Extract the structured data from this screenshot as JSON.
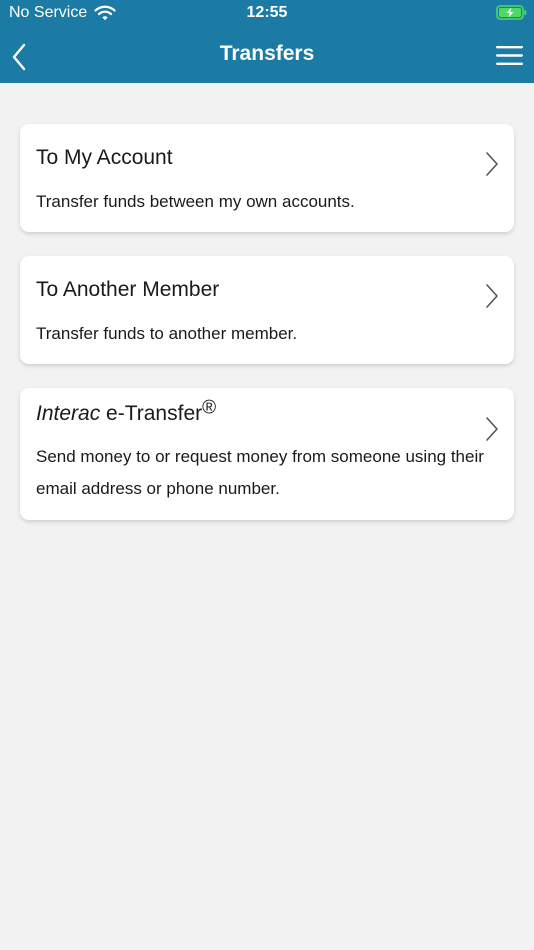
{
  "status_bar": {
    "carrier": "No Service",
    "time": "12:55",
    "wifi_icon": "wifi-icon",
    "battery_icon": "battery-charging-icon"
  },
  "nav": {
    "title": "Transfers",
    "back_icon": "chevron-left-icon",
    "menu_icon": "hamburger-menu-icon"
  },
  "colors": {
    "header_bg": "#1b7ba4",
    "page_bg": "#f2f2f2",
    "battery_green": "#4cd964"
  },
  "options": [
    {
      "title": "To My Account",
      "description": "Transfer funds between my own accounts."
    },
    {
      "title": "To Another Member",
      "description": "Transfer funds to another member."
    },
    {
      "title_italic": "Interac",
      "title_rest": " e-Transfer",
      "title_mark": "®",
      "description": "Send money to or request money from someone using their email address or phone number."
    }
  ]
}
